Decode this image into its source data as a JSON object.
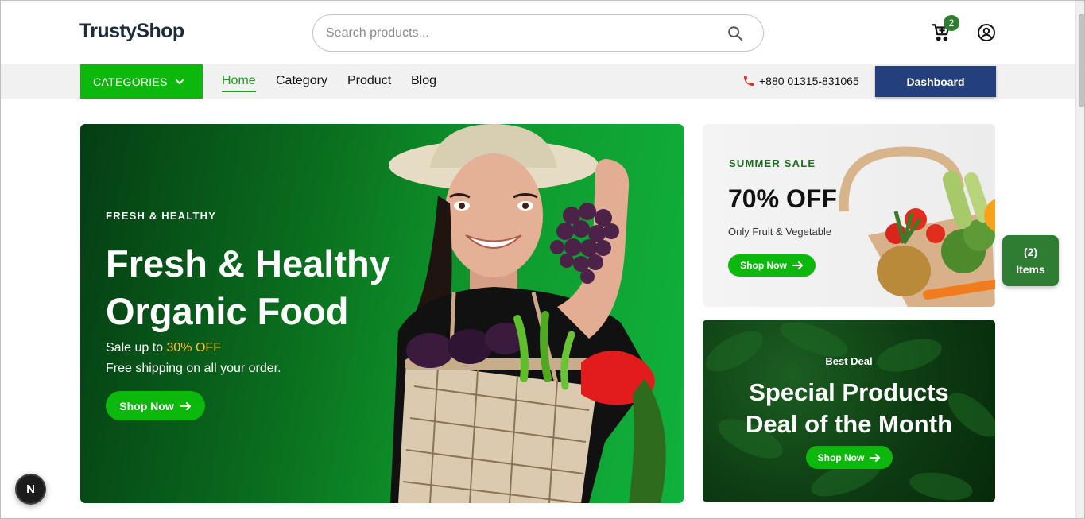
{
  "brand": {
    "logo_text": "TrustyShop"
  },
  "search": {
    "placeholder": "Search products..."
  },
  "header": {
    "cart_count": "2"
  },
  "nav": {
    "categories_label": "CATEGORIES",
    "links": [
      "Home",
      "Category",
      "Product",
      "Blog"
    ],
    "active": "Home",
    "phone": "+880 01315-831065",
    "dashboard_label": "Dashboard"
  },
  "hero": {
    "eyebrow": "FRESH & HEALTHY",
    "title": "Fresh & Healthy Organic Food",
    "sale_prefix": "Sale up to ",
    "sale_highlight": "30% OFF",
    "shipping": "Free shipping on all your order.",
    "button": "Shop Now"
  },
  "summer_sale": {
    "eyebrow": "SUMMER SALE",
    "title": "70% OFF",
    "subtitle": "Only Fruit & Vegetable",
    "button": "Shop Now"
  },
  "best_deal": {
    "eyebrow": "Best Deal",
    "title_line1": "Special Products",
    "title_line2": "Deal of the Month",
    "button": "Shop Now"
  },
  "floating_cart": {
    "count": "(2)",
    "label": "Items"
  },
  "dev_badge": {
    "letter": "N"
  },
  "colors": {
    "primary_green": "#0db80d",
    "dark_green": "#2e7d32",
    "navy": "#233f7d",
    "accent_yellow": "#ffc53a"
  }
}
